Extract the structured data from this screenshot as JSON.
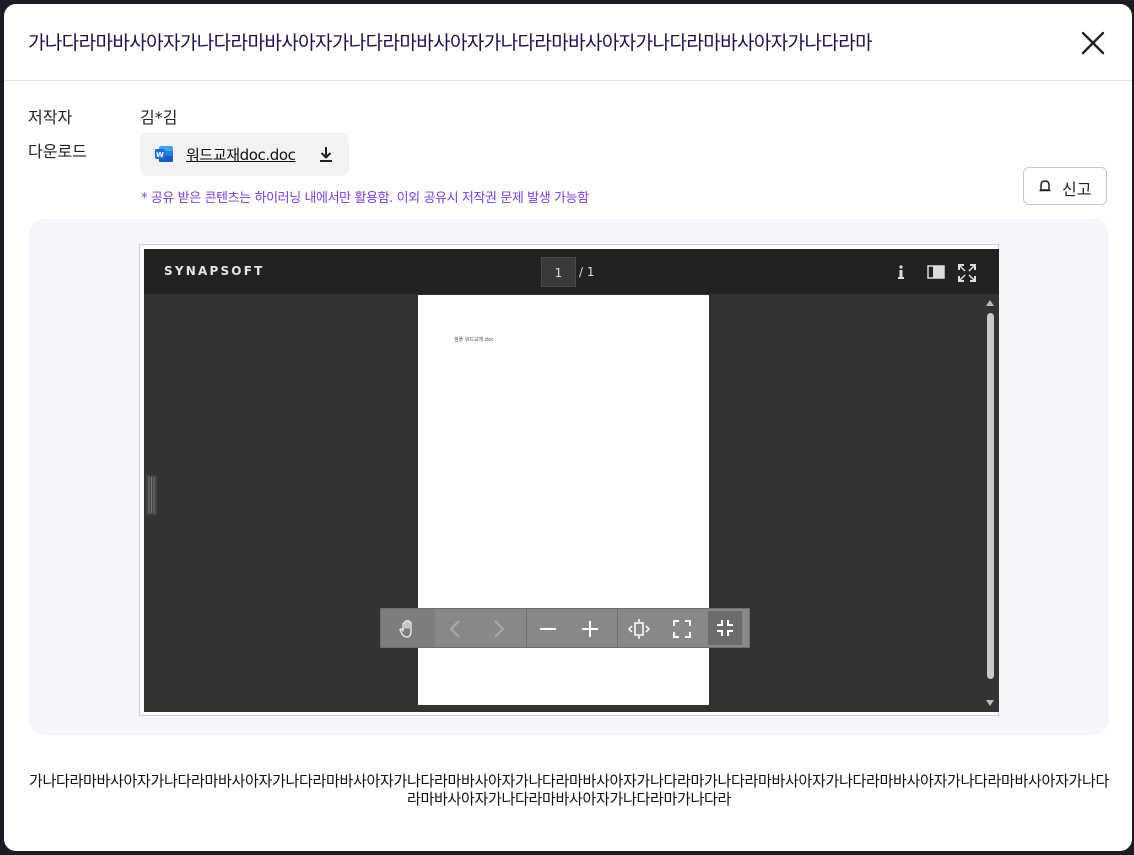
{
  "modal": {
    "title": "가나다라마바사아자가나다라마바사아자가나다라마바사아자가나다라마바사아자가나다라마바사아자가나다라마"
  },
  "meta": {
    "author_label": "저작자",
    "author_value": "김*김",
    "download_label": "다운로드",
    "file_name": "워드교재doc.doc"
  },
  "notice": "* 공유 받은 콘텐츠는 하이러닝 내에서만 활용함. 이외 공유시 저작권 문제 발생 가능함",
  "report_button": {
    "label": "신고"
  },
  "viewer": {
    "brand": "SYNAPSOFT",
    "current_page": "1",
    "total_pages": "/ 1",
    "document_text": "샘플 워드교재.doc"
  },
  "description": "가나다라마바사아자가나다라마바사아자가나다라마바사아자가나다라마바사아자가나다라마바사아자가나다라마가나다라마바사아자가나다라마바사아자가나다라마바사아자가나다라마바사아자가나다라마바사아자가나다라마가나다라",
  "colors": {
    "title": "#240f4a",
    "notice": "#7b3fd4",
    "word_icon": "#1e6fd9",
    "viewer_bg": "#333333",
    "viewer_toolbar": "#222222"
  },
  "icons": {
    "close": "close-icon",
    "word": "word-file-icon",
    "download": "download-icon",
    "report": "bell-icon",
    "info": "info-icon",
    "sidebar_toggle": "sidebar-toggle-icon",
    "fullscreen": "fullscreen-icon",
    "hand": "hand-icon",
    "prev": "chevron-left-icon",
    "next": "chevron-right-icon",
    "zoom_out": "minus-icon",
    "zoom_in": "plus-icon",
    "fit_width": "fit-width-icon",
    "fit_page": "fit-page-icon",
    "collapse": "collapse-icon"
  }
}
